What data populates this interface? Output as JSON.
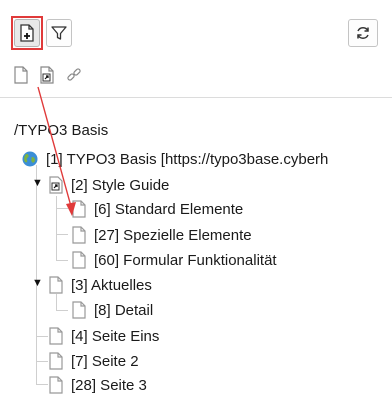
{
  "toolbar": {
    "new_page": "new-page-icon",
    "filter": "filter-icon",
    "refresh": "refresh-icon",
    "sub_icons": [
      "page-icon",
      "page-shortcut-icon",
      "link-icon"
    ]
  },
  "tree": {
    "mount_label": "/TYPO3 Basis",
    "root": "[1] TYPO3 Basis [https://typo3base.cyberh",
    "items": [
      {
        "label": "[2] Style Guide"
      },
      {
        "label": "[6] Standard Elemente"
      },
      {
        "label": "[27] Spezielle Elemente"
      },
      {
        "label": "[60] Formular Funktionalität"
      },
      {
        "label": "[3] Aktuelles"
      },
      {
        "label": "[8] Detail"
      },
      {
        "label": "[4] Seite Eins"
      },
      {
        "label": "[7] Seite 2"
      },
      {
        "label": "[28] Seite 3"
      }
    ]
  },
  "colors": {
    "highlight": "#e03a3a",
    "globe_blue": "#3b8ed6",
    "globe_green": "#7cb342"
  }
}
